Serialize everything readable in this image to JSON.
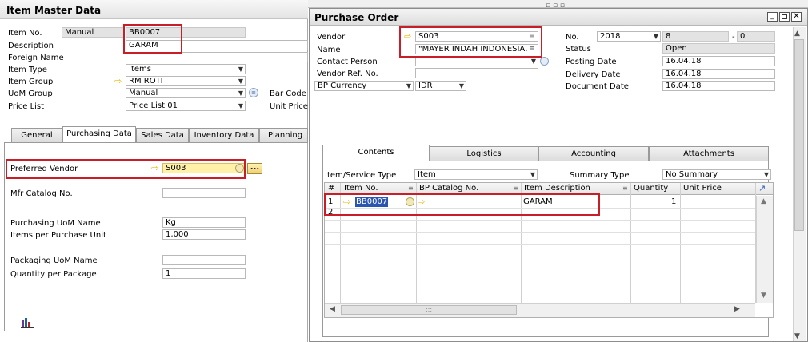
{
  "item_master": {
    "title": "Item Master Data",
    "item_no_label": "Item No.",
    "item_no_mode": "Manual",
    "item_no_value": "BB0007",
    "description_label": "Description",
    "description_value": "GARAM",
    "foreign_name_label": "Foreign Name",
    "item_type_label": "Item Type",
    "item_type_value": "Items",
    "item_group_label": "Item Group",
    "item_group_value": "RM ROTI",
    "uom_group_label": "UoM Group",
    "uom_group_value": "Manual",
    "price_list_label": "Price List",
    "price_list_value": "Price List 01",
    "bar_code_label": "Bar Code",
    "unit_price_label": "Unit Price",
    "tabs": [
      "General",
      "Purchasing Data",
      "Sales Data",
      "Inventory Data",
      "Planning D"
    ],
    "preferred_vendor_label": "Preferred Vendor",
    "preferred_vendor_value": "S003",
    "browse_label": "...",
    "mfr_catalog_label": "Mfr Catalog No.",
    "purch_uom_label": "Purchasing UoM Name",
    "purch_uom_value": "Kg",
    "items_per_unit_label": "Items per Purchase Unit",
    "items_per_unit_value": "1,000",
    "pack_uom_label": "Packaging UoM Name",
    "qty_per_pack_label": "Quantity per Package",
    "qty_per_pack_value": "1"
  },
  "purchase_order": {
    "title": "Purchase Order",
    "vendor_label": "Vendor",
    "vendor_value": "S003",
    "name_label": "Name",
    "name_value": "\"MAYER INDAH INDONESIA,",
    "contact_label": "Contact Person",
    "vendor_ref_label": "Vendor Ref. No.",
    "bp_currency_label": "BP Currency",
    "currency_value": "IDR",
    "no_label": "No.",
    "no_series": "2018",
    "no_value": "8",
    "no_dash": "-",
    "no_suffix": "0",
    "status_label": "Status",
    "status_value": "Open",
    "posting_label": "Posting Date",
    "posting_value": "16.04.18",
    "delivery_label": "Delivery Date",
    "delivery_value": "16.04.18",
    "document_label": "Document Date",
    "document_value": "16.04.18",
    "tabs": [
      "Contents",
      "Logistics",
      "Accounting",
      "Attachments"
    ],
    "item_service_label": "Item/Service Type",
    "item_service_value": "Item",
    "summary_type_label": "Summary Type",
    "summary_type_value": "No Summary",
    "columns": [
      "#",
      "Item No.",
      "BP Catalog No.",
      "Item Description",
      "Quantity",
      "Unit Price"
    ],
    "rows": [
      {
        "num": "1",
        "item_no": "BB0007",
        "catalog": "",
        "description": "GARAM",
        "quantity": "1",
        "unit_price": ""
      },
      {
        "num": "2",
        "item_no": "",
        "catalog": "",
        "description": "",
        "quantity": "",
        "unit_price": ""
      }
    ],
    "scroll_grip": ":::"
  },
  "colors": {
    "highlight_box": "#c81e28",
    "link_arrow": "#f2b400",
    "selected_field": "#fff2a8"
  }
}
